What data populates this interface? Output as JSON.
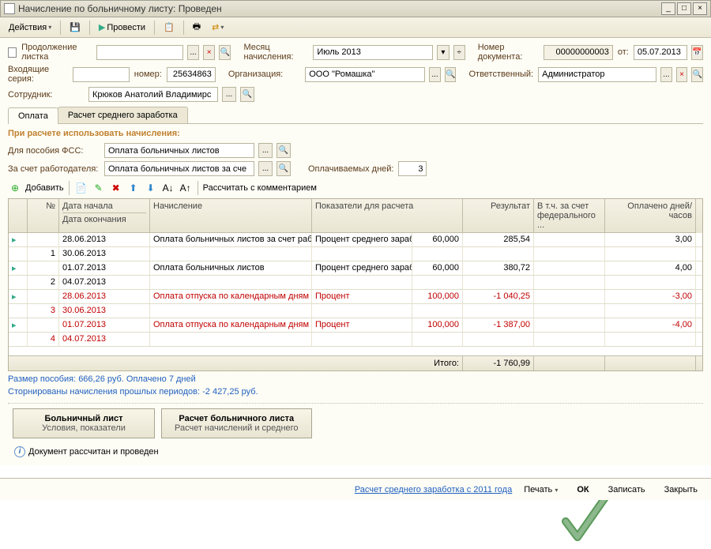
{
  "window": {
    "title": "Начисление по больничному листу: Проведен"
  },
  "toolbar": {
    "actions": "Действия",
    "provesti": "Провести"
  },
  "header": {
    "cont_label": "Продолжение листка",
    "month_label": "Месяц начисления:",
    "month_value": "Июль 2013",
    "docnum_label": "Номер документа:",
    "docnum_value": "00000000003",
    "ot_label": "от:",
    "ot_value": "05.07.2013",
    "inseries_label": "Входящие серия:",
    "innum_label": "номер:",
    "innum_value": "25634863",
    "org_label": "Организация:",
    "org_value": "ООО \"Ромашка\"",
    "resp_label": "Ответственный:",
    "resp_value": "Администратор",
    "emp_label": "Сотрудник:",
    "emp_value": "Крюков Анатолий Владимирс"
  },
  "tabs": {
    "t1": "Оплата",
    "t2": "Расчет среднего заработка"
  },
  "section": {
    "title": "При расчете использовать начисления:",
    "fss_label": "Для пособия ФСС:",
    "fss_value": "Оплата больничных листов",
    "employer_label": "За счет работодателя:",
    "employer_value": "Оплата больничных листов за сче",
    "paid_days_label": "Оплачиваемых дней:",
    "paid_days_value": "3"
  },
  "ttoolbar": {
    "add": "Добавить",
    "recalc": "Рассчитать с комментарием"
  },
  "grid": {
    "h_num": "№",
    "h_start": "Дата начала",
    "h_end": "Дата окончания",
    "h_calc": "Начисление",
    "h_ind": "Показатели для расчета",
    "h_res": "Результат",
    "h_fed": "В т.ч. за счет федерального ...",
    "h_days": "Оплачено дней/часов",
    "rows": [
      {
        "num": "1",
        "d1": "28.06.2013",
        "d2": "30.06.2013",
        "calc": "Оплата больничных листов за счет работодателя",
        "ind": "Процент среднего заработка",
        "indv": "60,000",
        "res": "285,54",
        "days": "3,00",
        "red": false
      },
      {
        "num": "2",
        "d1": "01.07.2013",
        "d2": "04.07.2013",
        "calc": "Оплата больничных листов",
        "ind": "Процент среднего заработка",
        "indv": "60,000",
        "res": "380,72",
        "days": "4,00",
        "red": false
      },
      {
        "num": "3",
        "d1": "28.06.2013",
        "d2": "30.06.2013",
        "calc": "Оплата отпуска по календарным дням",
        "ind": "Процент",
        "indv": "100,000",
        "res": "-1 040,25",
        "days": "-3,00",
        "red": true
      },
      {
        "num": "4",
        "d1": "01.07.2013",
        "d2": "04.07.2013",
        "calc": "Оплата отпуска по календарным дням",
        "ind": "Процент",
        "indv": "100,000",
        "res": "-1 387,00",
        "days": "-4,00",
        "red": true
      }
    ],
    "total_label": "Итого:",
    "total_value": "-1 760,99"
  },
  "info": {
    "line1": "Размер пособия: 666,26 руб. Оплачено 7 дней",
    "line2": "Сторнированы начисления прошлых периодов: -2 427,25 руб."
  },
  "buttons": {
    "b1_l1": "Больничный лист",
    "b1_l2": "Условия, показатели",
    "b2_l1": "Расчет больничного листа",
    "b2_l2": "Расчет начислений и среднего"
  },
  "status": "Документ рассчитан и проведен",
  "footer": {
    "link": "Расчет среднего заработка с 2011 года",
    "print": "Печать",
    "ok": "ОК",
    "save": "Записать",
    "close": "Закрыть"
  }
}
